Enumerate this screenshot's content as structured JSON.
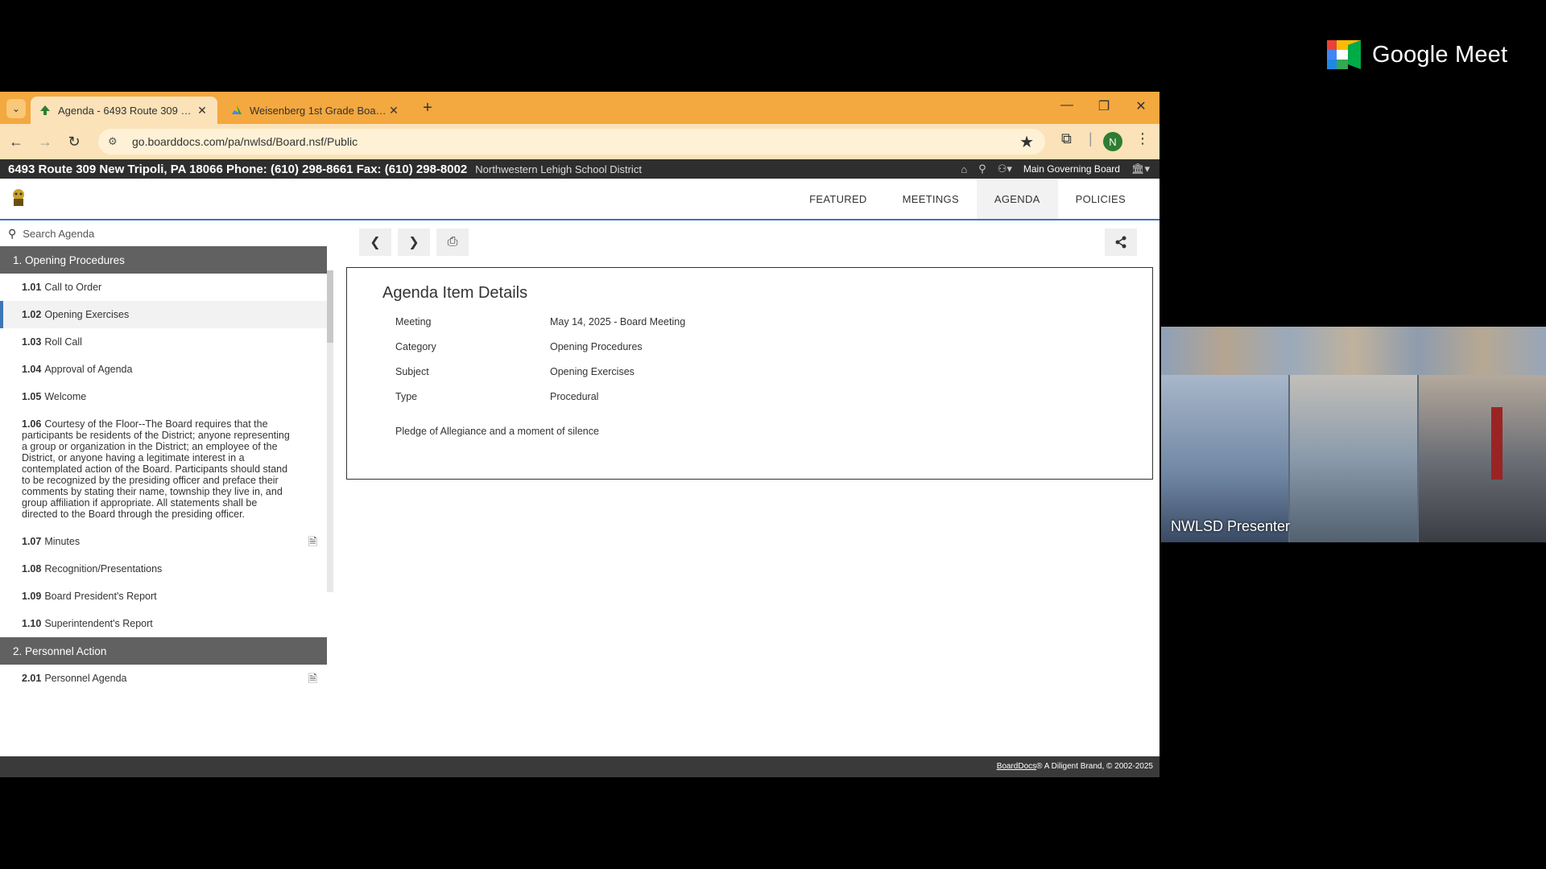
{
  "meet": {
    "logo_text": "Google Meet"
  },
  "browser": {
    "tabs": [
      {
        "title": "Agenda - 6493 Route 309 New",
        "active": true
      },
      {
        "title": "Weisenberg 1st Grade Board Pr",
        "active": false
      }
    ],
    "url": "go.boarddocs.com/pa/nwlsd/Board.nsf/Public",
    "profile_initial": "N"
  },
  "header": {
    "address": "6493 Route 309 New Tripoli, PA 18066 Phone: (610) 298-8661 Fax: (610) 298-8002",
    "district": "Northwestern Lehigh School District",
    "board": "Main Governing Board"
  },
  "nav": {
    "tabs": [
      "FEATURED",
      "MEETINGS",
      "AGENDA",
      "POLICIES"
    ],
    "active": "AGENDA"
  },
  "sidebar": {
    "search_placeholder": "Search Agenda",
    "categories": [
      {
        "title": "1. Opening Procedures",
        "items": [
          {
            "num": "1.01",
            "label": "Call to Order"
          },
          {
            "num": "1.02",
            "label": "Opening Exercises",
            "selected": true
          },
          {
            "num": "1.03",
            "label": "Roll Call"
          },
          {
            "num": "1.04",
            "label": "Approval of Agenda"
          },
          {
            "num": "1.05",
            "label": "Welcome"
          },
          {
            "num": "1.06",
            "label": "Courtesy of the Floor--The Board requires that the participants be residents of the District; anyone representing a group or organization in the District; an employee of the District, or anyone having a legitimate interest in a contemplated action of the Board. Participants should stand to be recognized by the presiding officer and preface their comments by stating their name, township they live in, and group affiliation if appropriate. All statements shall be directed to the Board through the presiding officer."
          },
          {
            "num": "1.07",
            "label": "Minutes",
            "has_doc": true
          },
          {
            "num": "1.08",
            "label": "Recognition/Presentations"
          },
          {
            "num": "1.09",
            "label": "Board President's Report"
          },
          {
            "num": "1.10",
            "label": "Superintendent's Report"
          }
        ]
      },
      {
        "title": "2. Personnel Action",
        "items": [
          {
            "num": "2.01",
            "label": "Personnel Agenda",
            "has_doc": true
          }
        ]
      }
    ]
  },
  "details": {
    "title": "Agenda Item Details",
    "rows": [
      {
        "label": "Meeting",
        "value": "May 14, 2025 - Board Meeting"
      },
      {
        "label": "Category",
        "value": "Opening Procedures"
      },
      {
        "label": "Subject",
        "value": "Opening Exercises"
      },
      {
        "label": "Type",
        "value": "Procedural"
      }
    ],
    "body": "Pledge of Allegiance and a moment of silence"
  },
  "footer": {
    "brand_link": "BoardDocs",
    "copyright": "® A Diligent Brand, © 2002-2025"
  },
  "presenter": {
    "caption": "NWLSD Presenter"
  }
}
